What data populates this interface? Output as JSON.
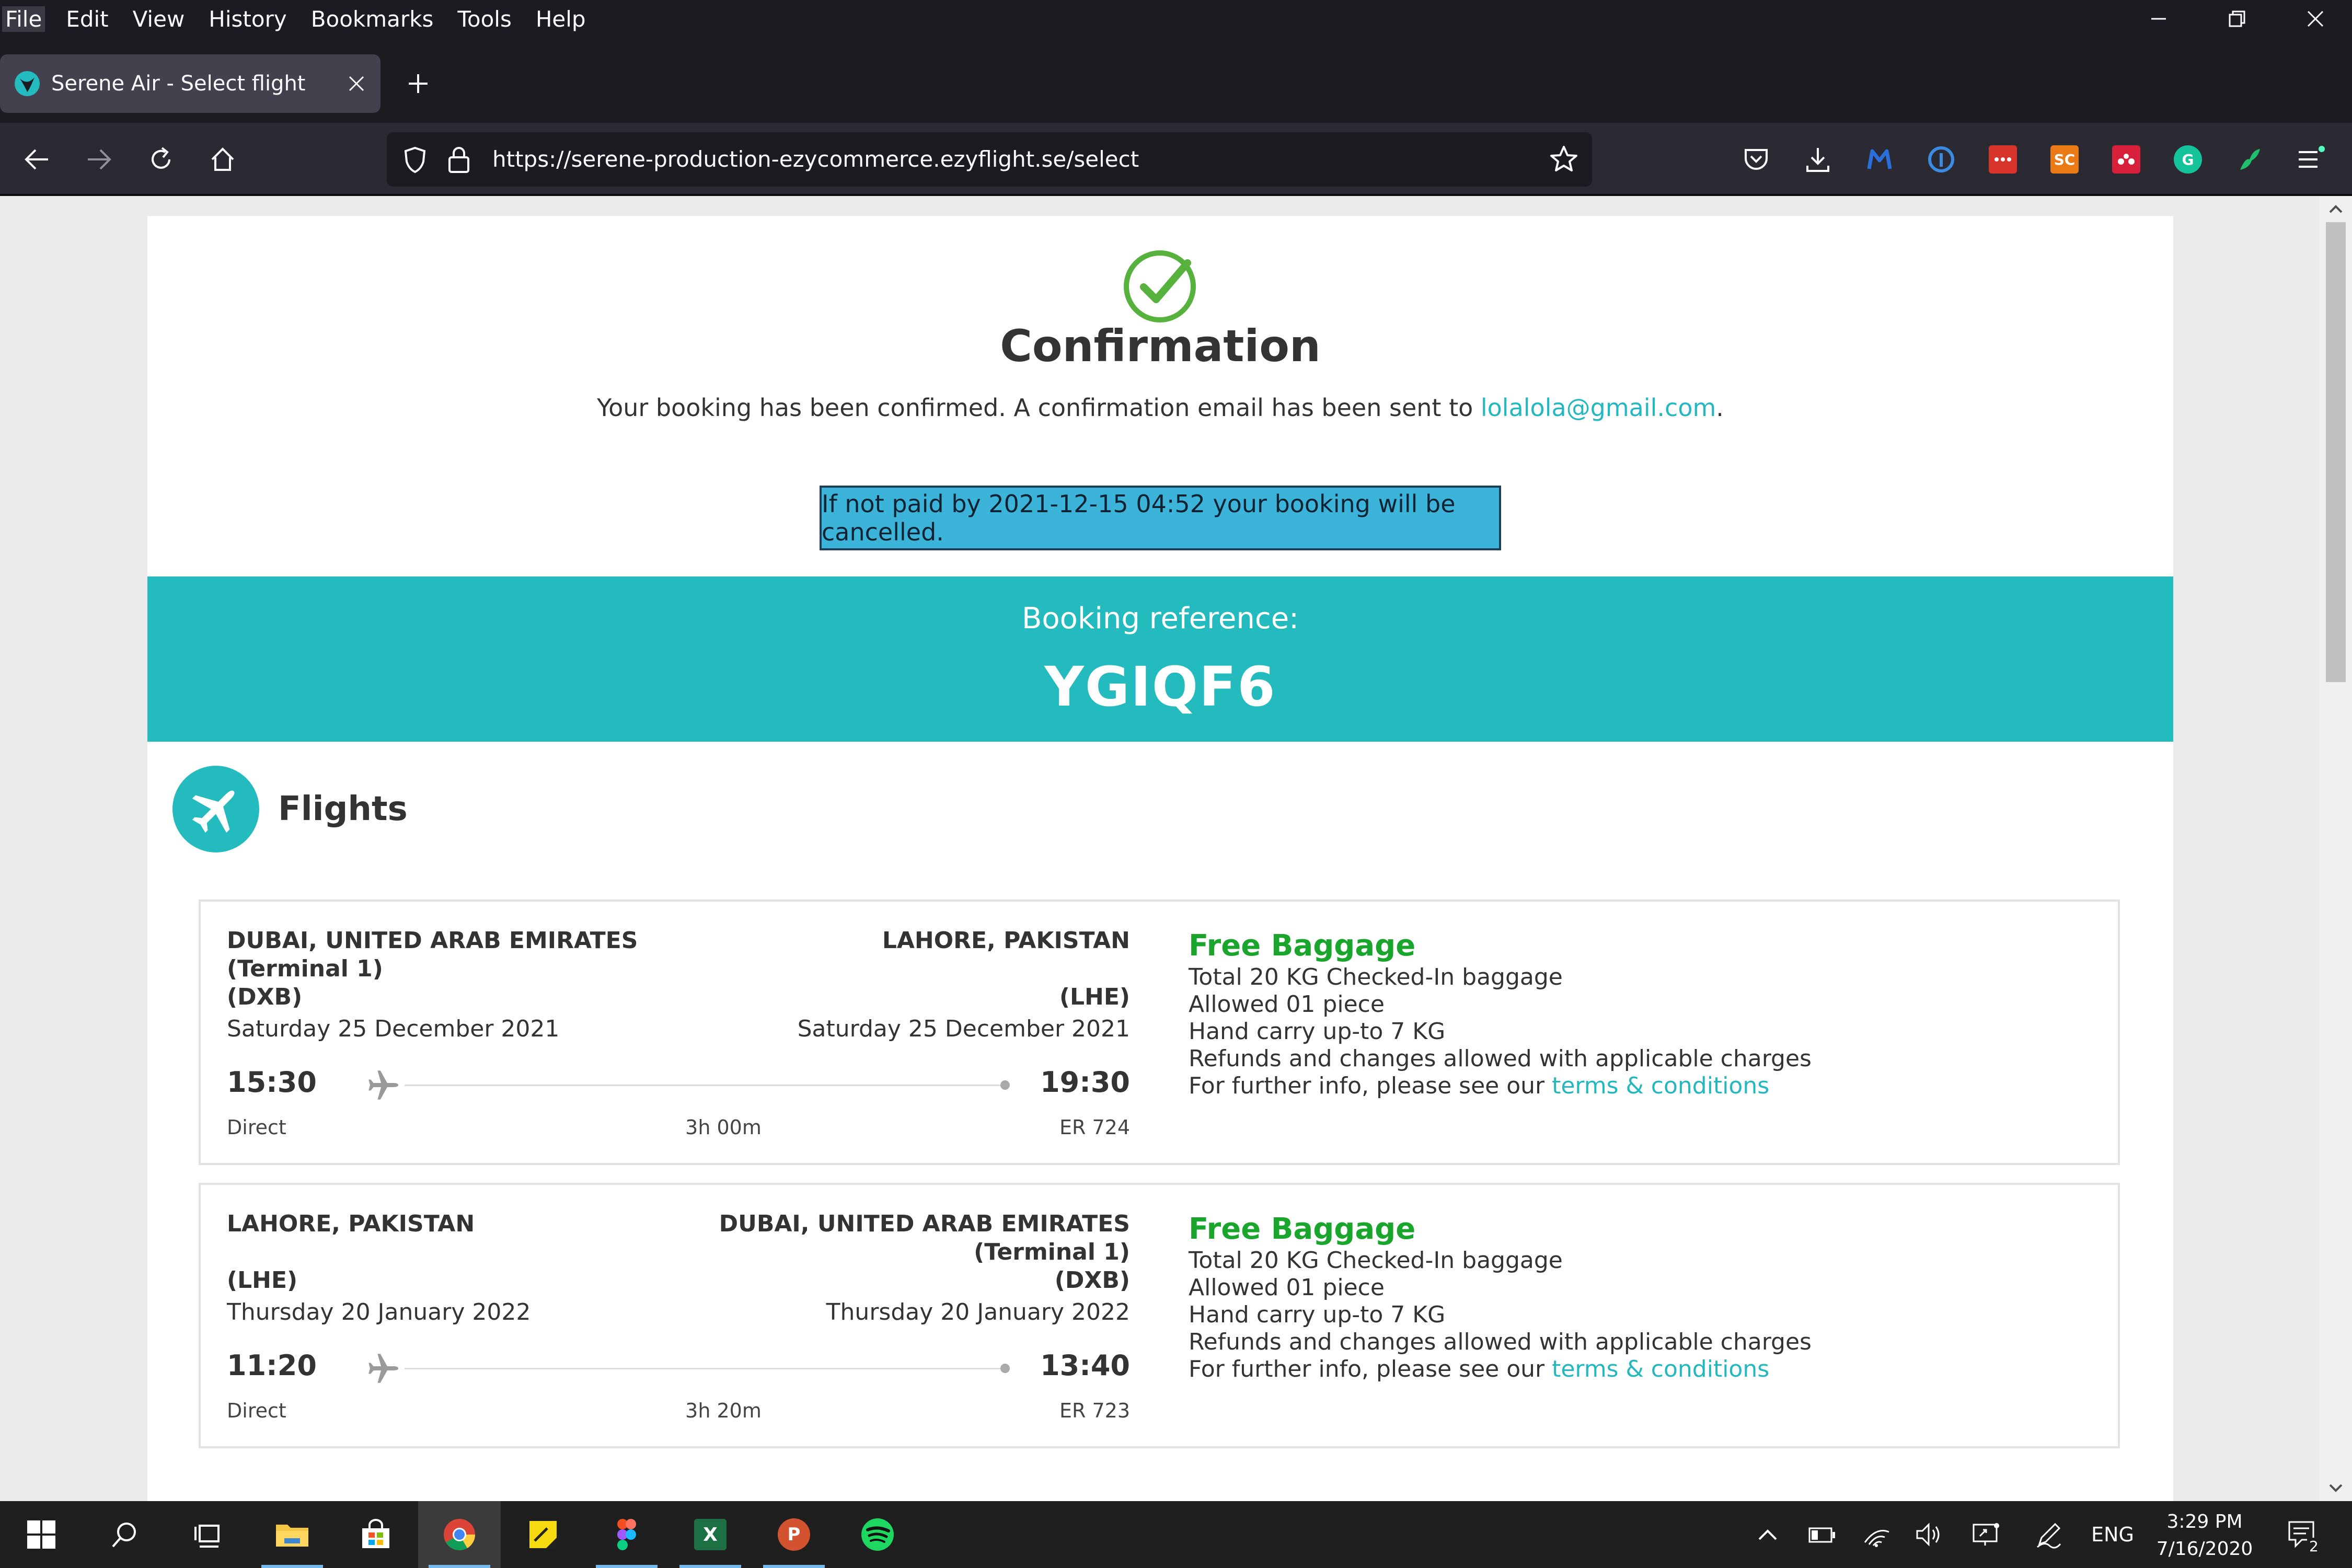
{
  "menu": [
    "File",
    "Edit",
    "View",
    "History",
    "Bookmarks",
    "Tools",
    "Help"
  ],
  "tab": {
    "title": "Serene Air - Select flight"
  },
  "url": "https://serene-production-ezycommerce.ezyflight.se/select",
  "confirmation": {
    "title": "Confirmation",
    "message_prefix": "Your booking has been confirmed. A confirmation email has been sent to ",
    "email": "lolalola@gmail.com",
    "message_suffix": ".",
    "notice": "If not paid by 2021-12-15 04:52 your booking will be cancelled."
  },
  "booking": {
    "label": "Booking reference:",
    "code": "YGIQF6"
  },
  "flights_section": {
    "title": "Flights"
  },
  "flights": [
    {
      "from_line1": "DUBAI, UNITED ARAB EMIRATES",
      "from_line2": "(Terminal 1)",
      "from_line3": "(DXB)",
      "to_line1": "LAHORE, PAKISTAN",
      "to_line2": "",
      "to_line3": "(LHE)",
      "from_date": "Saturday 25 December 2021",
      "to_date": "Saturday 25 December 2021",
      "dep_time": "15:30",
      "arr_time": "19:30",
      "type": "Direct",
      "duration": "3h 00m",
      "flight_no": "ER 724",
      "baggage": {
        "title": "Free Baggage",
        "line1": "Total 20 KG Checked-In baggage",
        "line2": "Allowed 01 piece",
        "line3": "Hand carry up-to 7 KG",
        "line4": "Refunds and changes allowed with applicable charges",
        "line5_prefix": "For further info, please see our ",
        "link": "terms & conditions"
      }
    },
    {
      "from_line1": "LAHORE, PAKISTAN",
      "from_line2": "",
      "from_line3": "(LHE)",
      "to_line1": "DUBAI, UNITED ARAB EMIRATES",
      "to_line2": "(Terminal 1)",
      "to_line3": "(DXB)",
      "from_date": "Thursday 20 January 2022",
      "to_date": "Thursday 20 January 2022",
      "dep_time": "11:20",
      "arr_time": "13:40",
      "type": "Direct",
      "duration": "3h 20m",
      "flight_no": "ER 723",
      "baggage": {
        "title": "Free Baggage",
        "line1": "Total 20 KG Checked-In baggage",
        "line2": "Allowed 01 piece",
        "line3": "Hand carry up-to 7 KG",
        "line4": "Refunds and changes allowed with applicable charges",
        "line5_prefix": "For further info, please see our ",
        "link": "terms & conditions"
      }
    }
  ],
  "extensions": {
    "sc_label": "SC",
    "g_label": "G"
  },
  "taskbar": {
    "excel_label": "X",
    "ppt_label": "P"
  },
  "tray": {
    "language": "ENG",
    "time": "3:29 PM",
    "date": "7/16/2020",
    "notifications": "2"
  },
  "colors": {
    "brand_teal": "#24bbbe",
    "success_green": "#1aa52c",
    "link_teal": "#23b8c0",
    "notice_blue": "#3cb3d8"
  }
}
